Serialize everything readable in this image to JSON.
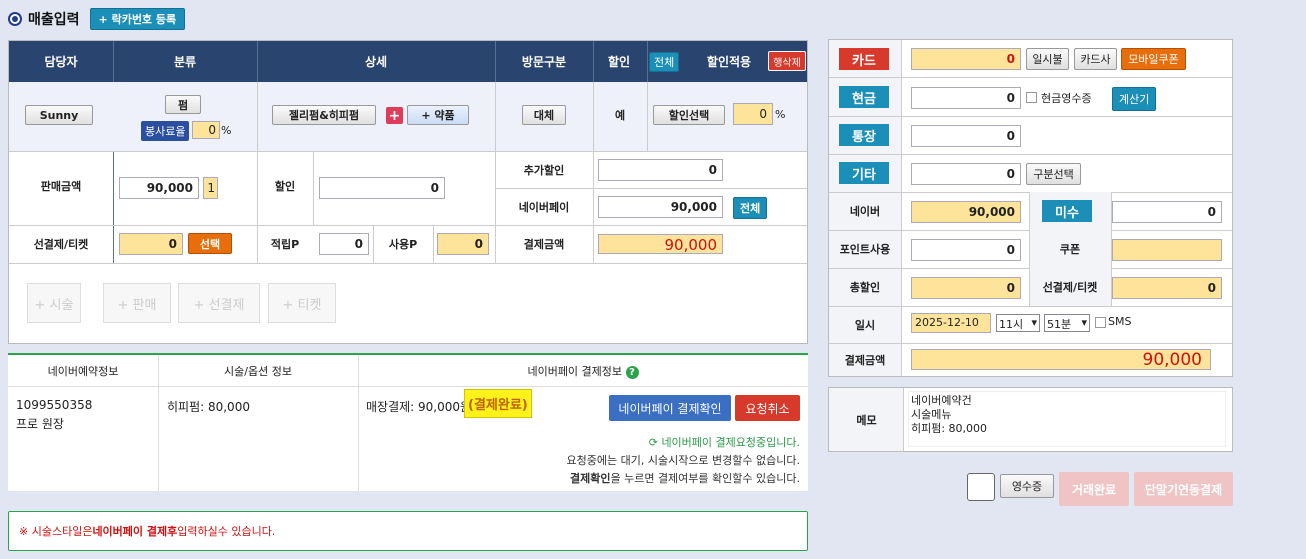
{
  "header": {
    "title": "매출입력",
    "locker_btn": "+ 락카번호 등록"
  },
  "grid": {
    "cols": [
      "담당자",
      "분류",
      "상세",
      "방문구분",
      "할인",
      "할인적용"
    ],
    "all_btn": "전체",
    "delete_btn": "행삭제",
    "staff": "Sunny",
    "category": "펌",
    "service_fee_label": "봉사료율",
    "service_fee": "0",
    "pct": "%",
    "detail": "젤리펌&히피펌",
    "drug_btn": "+ 약품",
    "visit": "대체",
    "discount": "예",
    "discount_sel": "할인선택",
    "discount_rate": "0"
  },
  "sales": {
    "sale_amount_label": "판매금액",
    "sale_amount": "90,000",
    "qty": "1",
    "discount_label": "할인",
    "discount": "0",
    "extra_discount_label": "추가할인",
    "extra_discount": "0",
    "naverpay_label": "네이버페이",
    "naverpay": "90,000",
    "all": "전체",
    "prepaid_label": "선결제/티켓",
    "prepaid": "0",
    "select": "선택",
    "earn_label": "적립P",
    "earn": "0",
    "use_label": "사용P",
    "use": "0",
    "pay_label": "결제금액",
    "pay": "90,000"
  },
  "actions": [
    "+ 시술",
    "+ 판매",
    "+ 선결제",
    "+ 티켓"
  ],
  "booking": {
    "col1": "네이버예약정보",
    "col2": "시술/옵션 정보",
    "col3": "네이버페이 결제정보",
    "id": "1099550358",
    "designer": "프로 원장",
    "service": "히피펌: 80,000",
    "store_pay": "매장결제: 90,000원",
    "status": "(결제완료)",
    "confirm_btn": "네이버페이 결제확인",
    "cancel_btn": "요청취소",
    "req_msg": "네이버페이 결제요청중입니다.",
    "msg1": "요청중에는 대기, 시술시작으로 변경할수 없습니다.",
    "msg2_bold": "결제확인",
    "msg2": "을 누르면 결제여부를 확인할수 있습니다."
  },
  "notice": {
    "pre": "※ 시술스타일은 ",
    "bold": "네이버페이 결제후",
    "post": " 입력하실수 있습니다."
  },
  "payment": {
    "card": "카드",
    "card_val": "0",
    "installment": "일시불",
    "card_co": "카드사",
    "mobile_coupon": "모바일쿠폰",
    "cash": "현금",
    "cash_val": "0",
    "cash_receipt": "현금영수증",
    "calc": "계산기",
    "bank": "통장",
    "bank_val": "0",
    "etc": "기타",
    "etc_val": "0",
    "type_sel": "구분선택",
    "naver": "네이버",
    "naver_val": "90,000",
    "unpaid": "미수",
    "unpaid_val": "0",
    "point": "포인트사용",
    "point_val": "0",
    "coupon": "쿠폰",
    "coupon_val": "",
    "total_disc": "총할인",
    "total_disc_val": "0",
    "prepaid": "선결제/티켓",
    "prepaid_val": "0",
    "datetime": "일시",
    "date": "2025-12-10",
    "hour": "11시",
    "minute": "51분",
    "sms": "SMS",
    "pay_amount": "결제금액",
    "pay_amount_val": "90,000"
  },
  "memo": {
    "label": "메모",
    "text": "네이버예약건\n시술메뉴\n히피펌: 80,000"
  },
  "footer": {
    "receipt": "영수증",
    "complete": "거래완료",
    "terminal": "단말기연동결제"
  },
  "colors": {
    "header_bg": "#2a4470",
    "teal": "#1b8fb8",
    "orange": "#e86d0b",
    "red": "#d73a2a",
    "yellow": "#fde49a"
  }
}
